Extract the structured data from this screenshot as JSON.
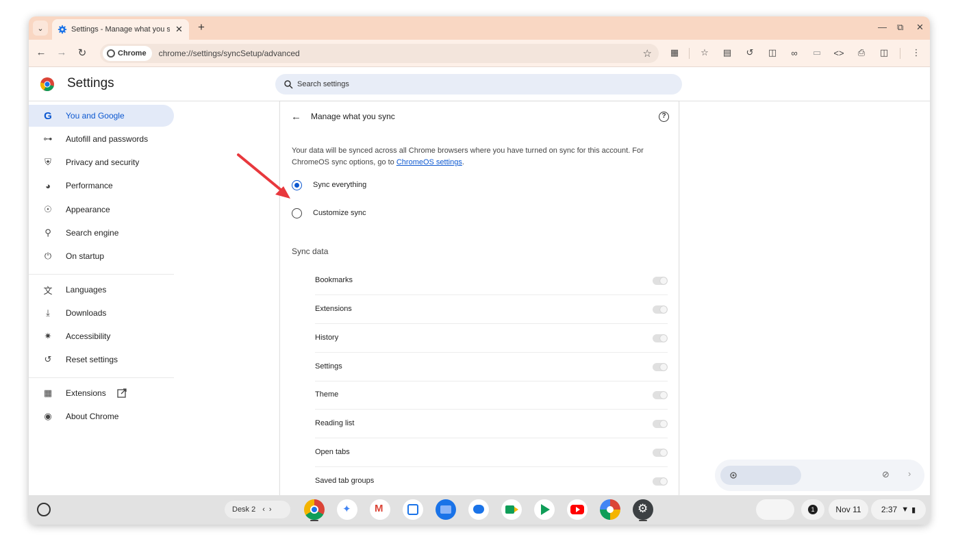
{
  "tab": {
    "title": "Settings - Manage what you sync"
  },
  "toolbar": {
    "chip_label": "Chrome",
    "url": "chrome://settings/syncSetup/advanced"
  },
  "settings": {
    "title": "Settings",
    "search_placeholder": "Search settings"
  },
  "sidebar": {
    "items": [
      {
        "label": "You and Google",
        "icon": "google-g-icon"
      },
      {
        "label": "Autofill and passwords",
        "icon": "key-icon"
      },
      {
        "label": "Privacy and security",
        "icon": "shield-icon"
      },
      {
        "label": "Performance",
        "icon": "gauge-icon"
      },
      {
        "label": "Appearance",
        "icon": "palette-icon"
      },
      {
        "label": "Search engine",
        "icon": "search-icon"
      },
      {
        "label": "On startup",
        "icon": "power-icon"
      },
      {
        "label": "Languages",
        "icon": "translate-icon"
      },
      {
        "label": "Downloads",
        "icon": "download-icon"
      },
      {
        "label": "Accessibility",
        "icon": "accessibility-icon"
      },
      {
        "label": "Reset settings",
        "icon": "reset-icon"
      },
      {
        "label": "Extensions",
        "icon": "puzzle-icon"
      },
      {
        "label": "About Chrome",
        "icon": "chrome-icon"
      }
    ]
  },
  "main": {
    "title": "Manage what you sync",
    "description": "Your data will be synced across all Chrome browsers where you have turned on sync for this account. For ChromeOS sync options, go to ",
    "description_link": "ChromeOS settings",
    "description_end": ".",
    "options": {
      "sync_everything": "Sync everything",
      "customize_sync": "Customize sync"
    },
    "section_label": "Sync data",
    "sync_items": [
      "Bookmarks",
      "Extensions",
      "History",
      "Settings",
      "Theme",
      "Reading list",
      "Open tabs",
      "Saved tab groups"
    ]
  },
  "shelf": {
    "desk_label": "Desk 2",
    "notification_count": "1",
    "date": "Nov 11",
    "time": "2:37"
  },
  "colors": {
    "accent": "#0b57d0",
    "tabstrip": "#f9d7c3",
    "toolbar": "#fdf0e8",
    "annotation_arrow": "#e8383d"
  }
}
